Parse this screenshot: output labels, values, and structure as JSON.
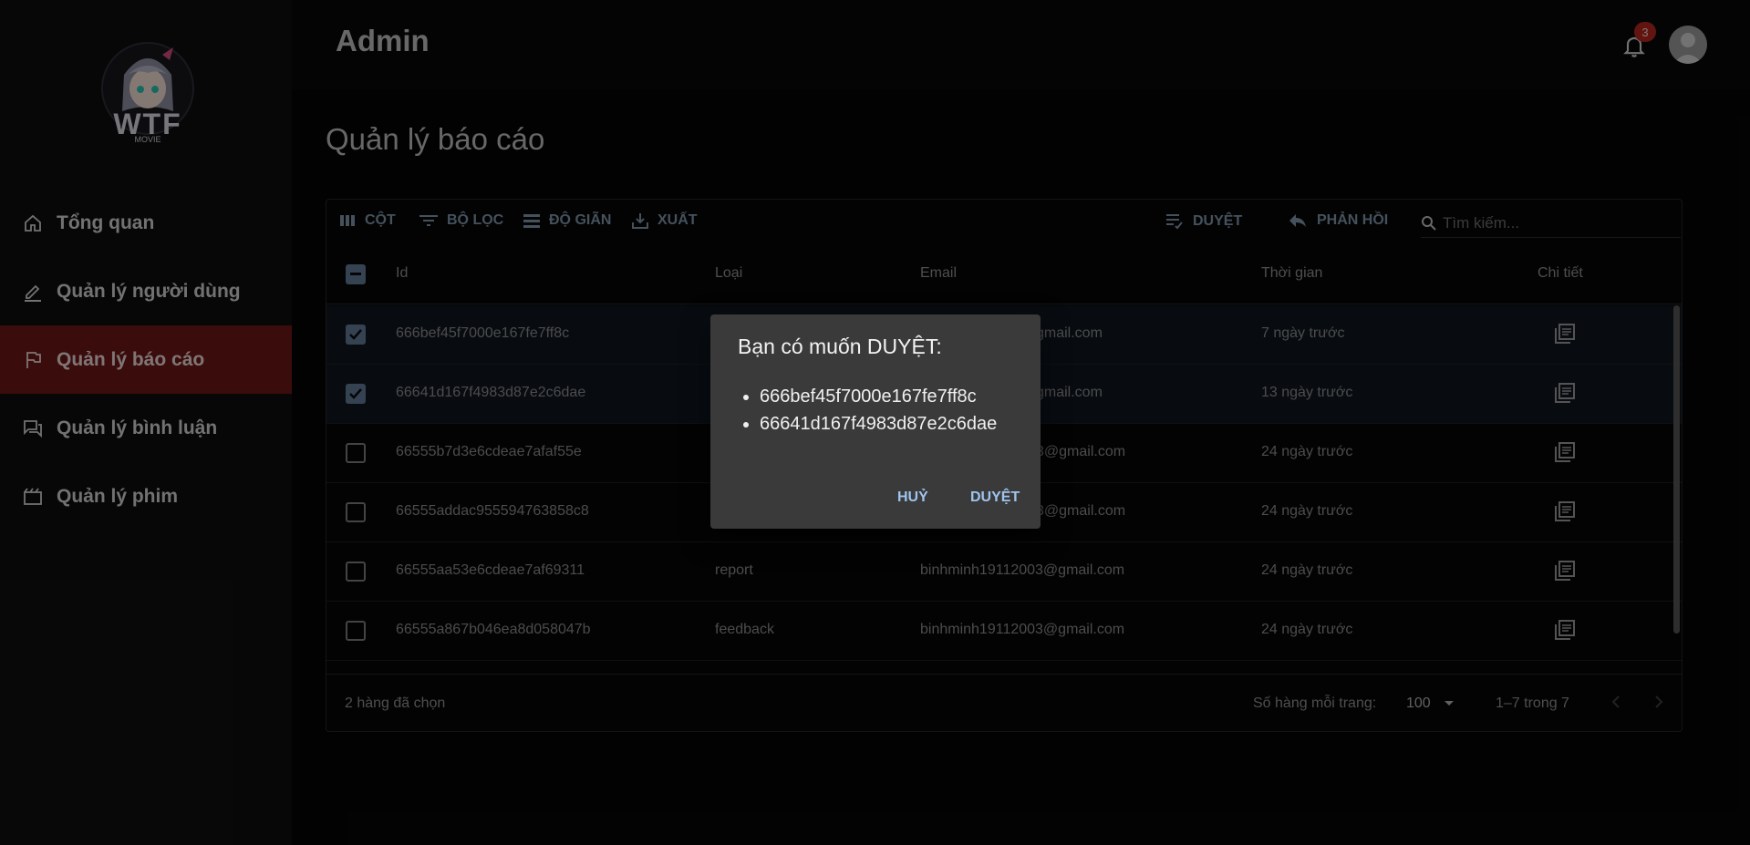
{
  "sidebar": {
    "logo_text": "WTF",
    "logo_subtext": "MOVIE",
    "items": [
      {
        "label": "Tổng quan",
        "icon": "home-icon",
        "active": false
      },
      {
        "label": "Quản lý người dùng",
        "icon": "edit-icon",
        "active": false
      },
      {
        "label": "Quản lý báo cáo",
        "icon": "flag-icon",
        "active": true
      },
      {
        "label": "Quản lý bình luận",
        "icon": "forum-icon",
        "active": false
      },
      {
        "label": "Quản lý phim",
        "icon": "movie-icon",
        "active": false
      }
    ]
  },
  "header": {
    "title": "Admin",
    "notification_count": "3"
  },
  "main": {
    "page_title": "Quản lý báo cáo",
    "toolbar": {
      "columns": "CỘT",
      "filter": "BỘ LỌC",
      "density": "ĐỘ GIÃN",
      "export": "XUẤT",
      "approve": "DUYỆT",
      "reply": "PHẢN HỒI",
      "search_placeholder": "Tìm kiếm..."
    },
    "columns": [
      "Id",
      "Loại",
      "Email",
      "Thời gian",
      "Chi tiết"
    ],
    "rows": [
      {
        "id": "666bef45f7000e167fe7ff8c",
        "type": "",
        "email": "gmail.com",
        "time": "7 ngày trước",
        "checked": true
      },
      {
        "id": "66641d167f4983d87e2c6dae",
        "type": "",
        "email": "gmail.com",
        "time": "13 ngày trước",
        "checked": true
      },
      {
        "id": "66555b7d3e6cdeae7afaf55e",
        "type": "",
        "email": "3@gmail.com",
        "time": "24 ngày trước",
        "checked": false
      },
      {
        "id": "66555addac955594763858c8",
        "type": "",
        "email": "3@gmail.com",
        "time": "24 ngày trước",
        "checked": false
      },
      {
        "id": "66555aa53e6cdeae7af69311",
        "type": "report",
        "email": "binhminh19112003@gmail.com",
        "time": "24 ngày trước",
        "checked": false
      },
      {
        "id": "66555a867b046ea8d058047b",
        "type": "feedback",
        "email": "binhminh19112003@gmail.com",
        "time": "24 ngày trước",
        "checked": false
      }
    ],
    "footer": {
      "selected": "2 hàng đã chọn",
      "rows_per_page_label": "Số hàng mỗi trang:",
      "rows_per_page_value": "100",
      "range": "1–7 trong 7"
    }
  },
  "dialog": {
    "title": "Bạn có muốn DUYỆT:",
    "items": [
      "666bef45f7000e167fe7ff8c",
      "66641d167f4983d87e2c6dae"
    ],
    "cancel": "HUỶ",
    "confirm": "DUYỆT"
  },
  "colors": {
    "accent": "#6b1616",
    "primary": "#9fc4ee",
    "badge": "#b3261e"
  }
}
